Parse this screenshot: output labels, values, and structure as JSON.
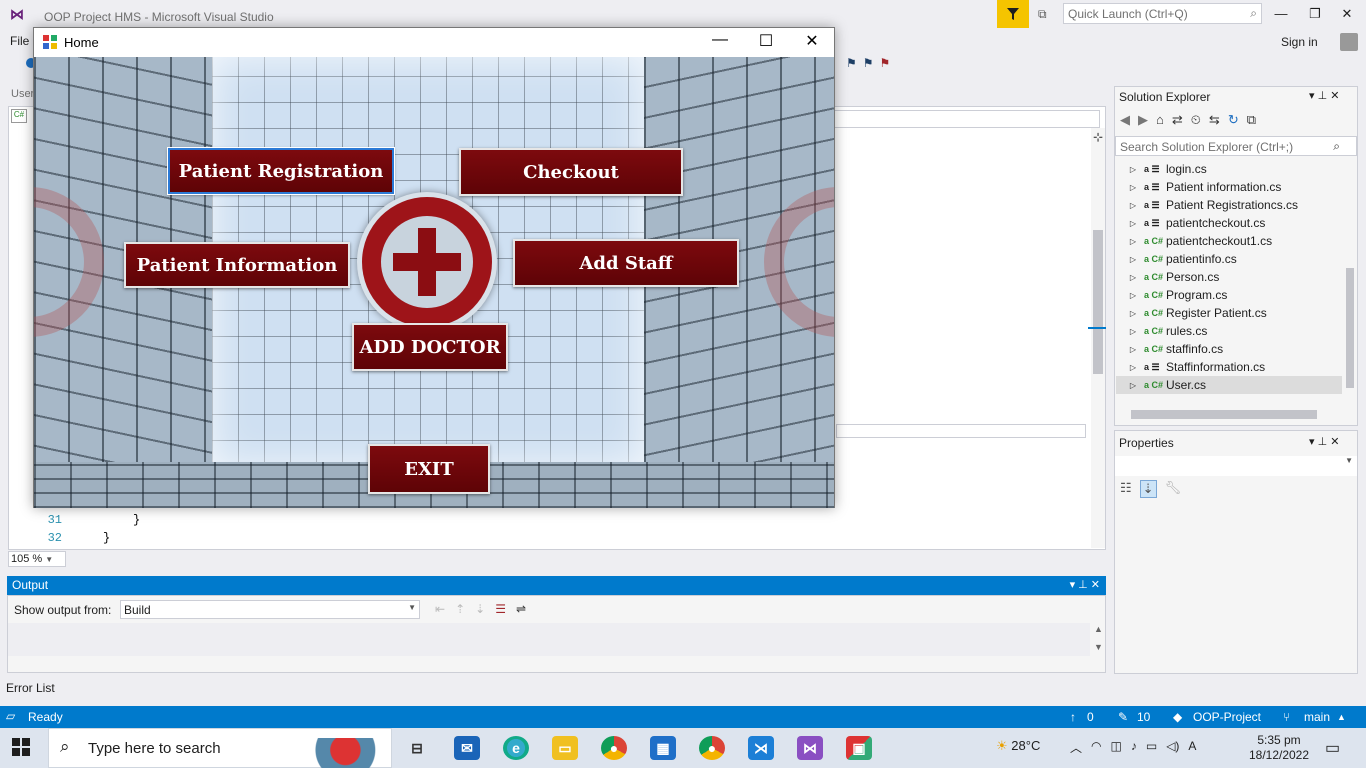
{
  "vs": {
    "title": "OOP Project HMS - Microsoft Visual Studio",
    "quick_launch_placeholder": "Quick Launch (Ctrl+Q)",
    "menu_file": "File",
    "sign_in": "Sign in",
    "editor_tab": "User",
    "line_numbers": [
      "31",
      "32"
    ],
    "code_lines": [
      "}",
      "}"
    ],
    "zoom": "105 %"
  },
  "home_form": {
    "title": "Home",
    "buttons": {
      "patient_registration": "Patient Registration",
      "checkout": "Checkout",
      "patient_information": "Patient Information",
      "add_staff": "Add Staff",
      "add_doctor": "ADD DOCTOR",
      "exit": "EXIT"
    },
    "colors": {
      "button_bg": "#6e070b",
      "logo_red": "#9e1419"
    }
  },
  "solution_explorer": {
    "title": "Solution Explorer",
    "search_placeholder": "Search Solution Explorer (Ctrl+;)",
    "items": [
      {
        "label": "login.cs",
        "type": "form"
      },
      {
        "label": "Patient information.cs",
        "type": "form"
      },
      {
        "label": "Patient Registrationcs.cs",
        "type": "form"
      },
      {
        "label": "patientcheckout.cs",
        "type": "form"
      },
      {
        "label": "patientcheckout1.cs",
        "type": "cs"
      },
      {
        "label": "patientinfo.cs",
        "type": "cs"
      },
      {
        "label": "Person.cs",
        "type": "cs"
      },
      {
        "label": "Program.cs",
        "type": "cs"
      },
      {
        "label": "Register Patient.cs",
        "type": "cs"
      },
      {
        "label": "rules.cs",
        "type": "cs"
      },
      {
        "label": "staffinfo.cs",
        "type": "cs"
      },
      {
        "label": "Staffinformation.cs",
        "type": "form"
      },
      {
        "label": "User.cs",
        "type": "cs"
      }
    ],
    "selected_item": "User.cs"
  },
  "properties": {
    "title": "Properties"
  },
  "output": {
    "title": "Output",
    "show_from_label": "Show output from:",
    "source": "Build"
  },
  "error_list": "Error List",
  "status": {
    "ready": "Ready",
    "up_count": "0",
    "edit_count": "10",
    "project": "OOP-Project",
    "branch": "main"
  },
  "taskbar": {
    "search_placeholder": "Type here to search",
    "temperature": "28°C",
    "time": "5:35 pm",
    "date": "18/12/2022"
  }
}
